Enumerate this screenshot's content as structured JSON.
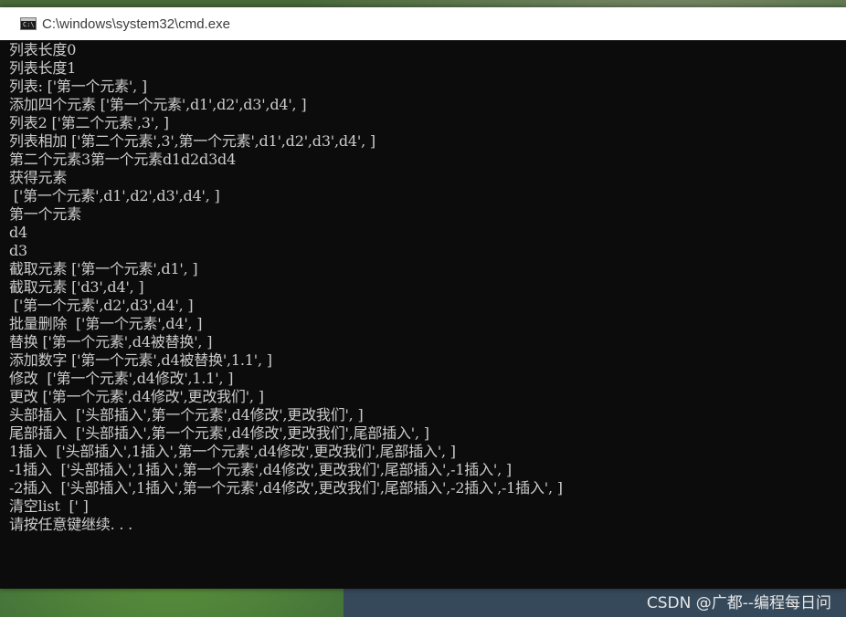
{
  "window": {
    "title": "C:\\windows\\system32\\cmd.exe",
    "icon": "cmd-icon"
  },
  "console": {
    "lines": [
      "列表长度0",
      "列表长度1",
      "列表: ['第一个元素', ]",
      "添加四个元素 ['第一个元素',d1',d2',d3',d4', ]",
      "列表2 ['第二个元素',3', ]",
      "列表相加 ['第二个元素',3',第一个元素',d1',d2',d3',d4', ]",
      "第二个元素3第一个元素d1d2d3d4",
      "获得元素",
      " ['第一个元素',d1',d2',d3',d4', ]",
      "第一个元素",
      "d4",
      "d3",
      "截取元素 ['第一个元素',d1', ]",
      "截取元素 ['d3',d4', ]",
      " ['第一个元素',d2',d3',d4', ]",
      "批量删除  ['第一个元素',d4', ]",
      "替换 ['第一个元素',d4被替换', ]",
      "添加数字 ['第一个元素',d4被替换',1.1', ]",
      "修改  ['第一个元素',d4修改',1.1', ]",
      "更改 ['第一个元素',d4修改',更改我们', ]",
      "头部插入  ['头部插入',第一个元素',d4修改',更改我们', ]",
      "尾部插入  ['头部插入',第一个元素',d4修改',更改我们',尾部插入', ]",
      "1插入  ['头部插入',1插入',第一个元素',d4修改',更改我们',尾部插入', ]",
      "-1插入  ['头部插入',1插入',第一个元素',d4修改',更改我们',尾部插入',-1插入', ]",
      "-2插入  ['头部插入',1插入',第一个元素',d4修改',更改我们',尾部插入',-2插入',-1插入', ]",
      "清空list  [' ]",
      "请按任意键继续. . ."
    ]
  },
  "watermark": {
    "text": "CSDN @广都--编程每日问"
  },
  "colors": {
    "console_bg": "#0c0c0c",
    "console_text": "#cccccc",
    "titlebar_bg": "#ffffff"
  }
}
